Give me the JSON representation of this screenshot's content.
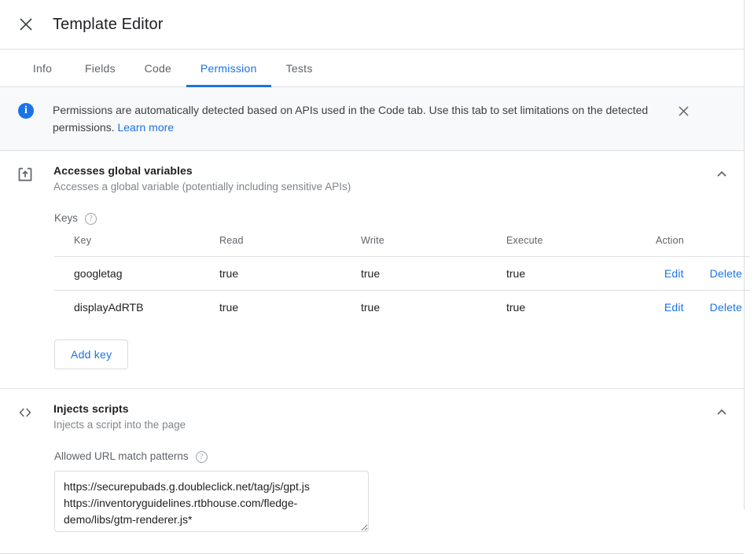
{
  "header": {
    "title": "Template Editor",
    "close_icon": "close-icon"
  },
  "tabs": [
    {
      "label": "Info",
      "active": false
    },
    {
      "label": "Fields",
      "active": false
    },
    {
      "label": "Code",
      "active": false
    },
    {
      "label": "Permission",
      "active": true
    },
    {
      "label": "Tests",
      "active": false
    }
  ],
  "banner": {
    "icon": "info-icon",
    "text": "Permissions are automatically detected based on APIs used in the Code tab. Use this tab to set limitations on the detected permissions.",
    "link_label": "Learn more",
    "close_icon": "close-icon",
    "background": "#f8f9fa",
    "icon_color": "#1a73e8"
  },
  "sections": [
    {
      "id": "accesses-global-variables",
      "icon": "export-box-arrow-up-icon",
      "title": "Accesses global variables",
      "subtitle": "Accesses a global variable (potentially including sensitive APIs)",
      "expanded": true,
      "expander_icon": "chevron-up-icon",
      "keys_label": "Keys",
      "keys_help_icon": "help-circle-icon",
      "table": {
        "columns": [
          "Key",
          "Read",
          "Write",
          "Execute",
          "Action"
        ],
        "rows": [
          {
            "key": "googletag",
            "read": "true",
            "write": "true",
            "execute": "true",
            "edit_label": "Edit",
            "delete_label": "Delete"
          },
          {
            "key": "displayAdRTB",
            "read": "true",
            "write": "true",
            "execute": "true",
            "edit_label": "Edit",
            "delete_label": "Delete"
          }
        ]
      },
      "add_key_label": "Add key"
    },
    {
      "id": "injects-scripts",
      "icon": "code-brackets-icon",
      "title": "Injects scripts",
      "subtitle": "Injects a script into the page",
      "expanded": true,
      "expander_icon": "chevron-up-icon",
      "url_field_label": "Allowed URL match patterns",
      "url_field_help_icon": "help-circle-icon",
      "url_patterns_value": "https://securepubads.g.doubleclick.net/tag/js/gpt.js\nhttps://inventoryguidelines.rtbhouse.com/fledge-demo/libs/gtm-renderer.js*",
      "url_patterns_placeholder": ""
    }
  ],
  "colors": {
    "accent": "#1a73e8",
    "text_primary": "#202124",
    "text_secondary": "#5f6368",
    "text_muted": "#80868b",
    "divider": "#e0e0e0"
  }
}
